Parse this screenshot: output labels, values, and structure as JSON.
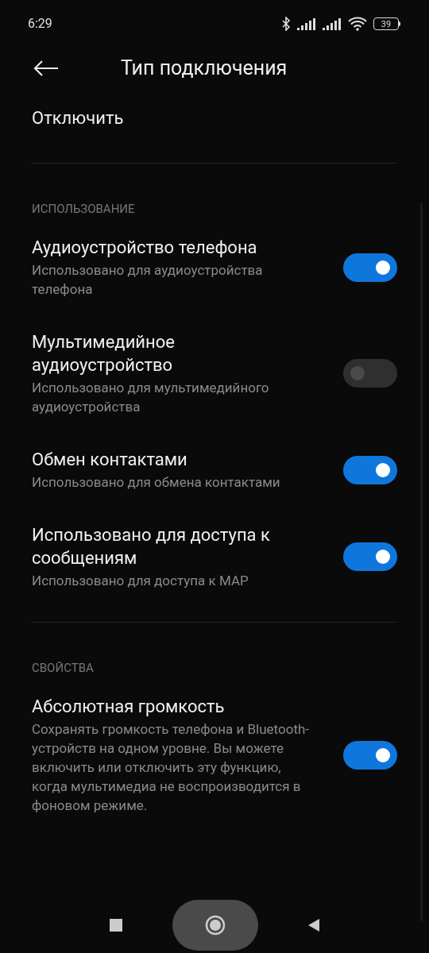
{
  "status_bar": {
    "time": "6:29",
    "battery": "39"
  },
  "header": {
    "title": "Тип подключения"
  },
  "disconnect": {
    "label": "Отключить"
  },
  "sections": [
    {
      "title": "ИСПОЛЬЗОВАНИЕ",
      "items": [
        {
          "title": "Аудиоустройство телефона",
          "subtitle": "Использовано для аудиоустройства телефона",
          "on": true
        },
        {
          "title": "Мультимедийное аудиоустройство",
          "subtitle": "Использовано для мультимедийного аудиоустройства",
          "on": false
        },
        {
          "title": "Обмен контактами",
          "subtitle": "Использовано для обмена контактами",
          "on": true
        },
        {
          "title": "Использовано для доступа к сообщениям",
          "subtitle": "Использовано для доступа к MAP",
          "on": true
        }
      ]
    },
    {
      "title": "СВОЙСТВА",
      "items": [
        {
          "title": "Абсолютная громкость",
          "subtitle": "Сохранять громкость телефона и Bluetooth-устройств на одном уровне. Вы можете включить или отключить эту функцию, когда мультимедиа не воспроизводится в фоновом режиме.",
          "on": true
        }
      ]
    }
  ]
}
